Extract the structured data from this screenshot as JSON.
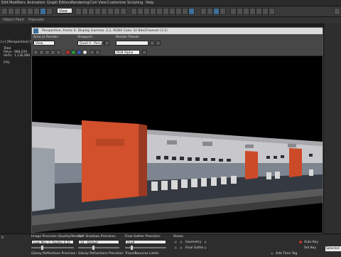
{
  "menubar": {
    "items": [
      "Edit",
      "Modifiers",
      "Animation",
      "Graph Editors",
      "Rendering",
      "Civil View",
      "Customize",
      "Scripting",
      "Help"
    ]
  },
  "toolbar": {
    "view_dropdown": "View"
  },
  "strip2": {
    "left_label": "Object Paint",
    "mid_label": "Populate"
  },
  "viewport": {
    "label": "[+] [Perspective] [Sta",
    "stats": {
      "total_label": "Total",
      "polys_label": "Polys:",
      "polys_value": "988,020",
      "verts_label": "Verts:",
      "verts_value": "1,136,980",
      "fps_label": "FPS:"
    }
  },
  "render_window": {
    "title": "Perspective, frame 0, Display Gamma: 2,2, RGBA Color 32 Bits/Channel (1:1)",
    "area_label": "Area to Render:",
    "area_value": "View",
    "viewport_label": "Viewport:",
    "viewport_value": "Quad 4 - Perspec",
    "preset_label": "Render Preset:",
    "preset_value": "",
    "channel_value": "RGB Alpha",
    "swatch_colors": [
      "#c43030",
      "#2f9e3a",
      "#3a5cc8",
      "#f0f0f0"
    ]
  },
  "bottom_panel": {
    "img_precision_label": "Image Precision (Quality/Noise):",
    "img_precision_value": "Low: Min: 1; Quality 0.25",
    "soft_shadows_label": "Soft Shadows Precision:",
    "soft_shadows_value": "1X - Default",
    "final_gather_label": "Final Gather Precision:",
    "final_gather_value": "Draft",
    "reuse_label": "Reuse",
    "geometry_label": "Geometry",
    "final_gather_check_label": "Final Gather",
    "glossy_reflections_label": "Glossy Reflections Precision:",
    "glossy_refractions_label": "Glossy Refractions Precision:",
    "trace_label": "Trace/Bounces Limits",
    "status_value": "Selected",
    "add_time_tag_label": "Add Time Tag",
    "auto_key_label": "Auto Key",
    "set_key_label": "Set Key",
    "timeline_value": "0"
  }
}
